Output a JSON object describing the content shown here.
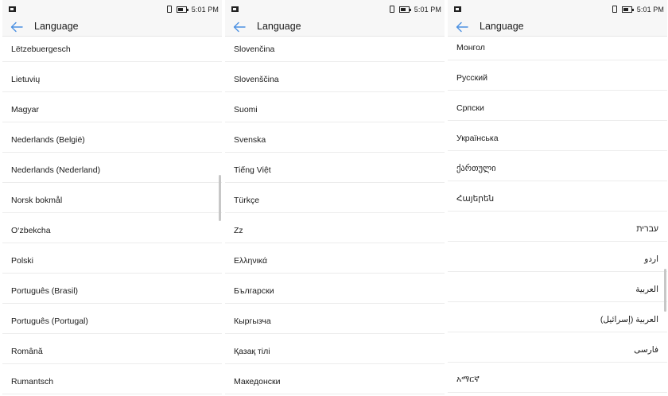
{
  "status": {
    "time": "5:01 PM"
  },
  "screens": [
    {
      "title": "Language",
      "languages": [
        "Lëtzebuergesch",
        "Lietuvių",
        "Magyar",
        "Nederlands (België)",
        "Nederlands (Nederland)",
        "Norsk bokmål",
        "O‘zbekcha",
        "Polski",
        "Português (Brasil)",
        "Português (Portugal)",
        "Română",
        "Rumantsch"
      ]
    },
    {
      "title": "Language",
      "languages": [
        "Slovenčina",
        "Slovenščina",
        "Suomi",
        "Svenska",
        "Tiếng Việt",
        "Türkçe",
        "Zz",
        "Ελληνικά",
        "Български",
        "Кыргызча",
        "Қазақ тілі",
        "Македонски"
      ]
    },
    {
      "title": "Language",
      "languages": [
        "Монгол",
        "Русский",
        "Српски",
        "Українська",
        "ქართული",
        "Հայերեն",
        "עברית",
        "اردو",
        "العربية",
        "العربية (إسرائيل)",
        "فارسی",
        "አማርኛ"
      ]
    }
  ],
  "colors": {
    "accent": "#4a90e2",
    "background": "#ffffff",
    "bar": "#f7f7f7",
    "divider": "#ececec"
  },
  "icons": {
    "back": "back-arrow-icon",
    "notification": "image-notification-icon",
    "vibrate": "vibrate-icon",
    "battery": "battery-icon"
  }
}
